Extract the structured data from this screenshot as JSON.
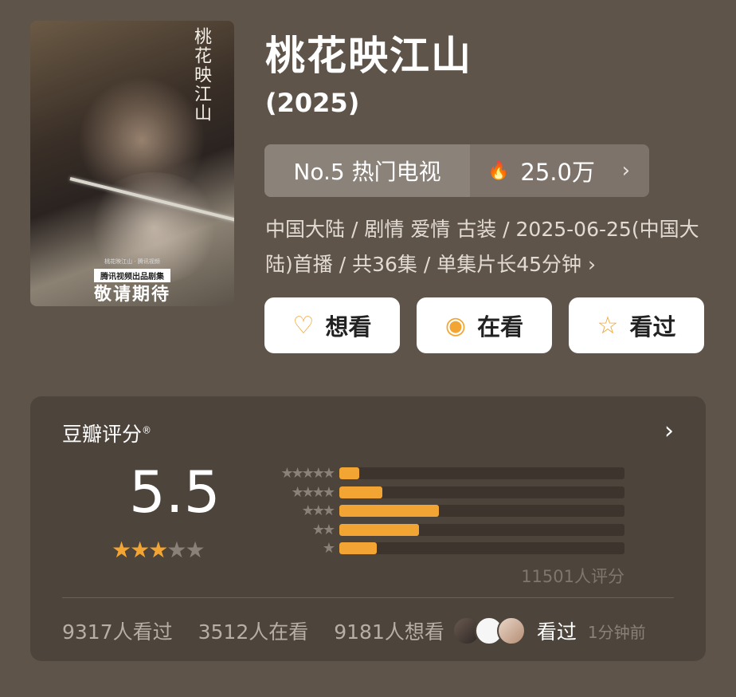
{
  "poster": {
    "calligraphy": "桃花映江山",
    "fineprint": "桃花映江山 · 腾讯视频",
    "presenter": "腾讯视频出品剧集",
    "coming_soon": "敬请期待"
  },
  "title": "桃花映江山",
  "year": "(2025)",
  "rank": {
    "label": "No.5 热门电视",
    "heat": "25.0万"
  },
  "meta": "中国大陆 / 剧情 爱情 古装 / 2025-06-25(中国大陆)首播 / 共36集 / 单集片长45分钟",
  "buttons": {
    "want": "想看",
    "watching": "在看",
    "watched": "看过"
  },
  "rating": {
    "title": "豆瓣评分",
    "title_mark": "®",
    "score": "5.5",
    "stars_filled": 3,
    "stars_total": 5,
    "distribution": [
      {
        "stars": 5,
        "fraction": 0.07
      },
      {
        "stars": 4,
        "fraction": 0.15
      },
      {
        "stars": 3,
        "fraction": 0.35
      },
      {
        "stars": 2,
        "fraction": 0.28
      },
      {
        "stars": 1,
        "fraction": 0.13
      }
    ],
    "count": "11501人评分"
  },
  "stats": {
    "watched": "9317人看过",
    "watching": "3512人在看",
    "want": "9181人想看",
    "recent_action": "看过",
    "recent_time": "1分钟前"
  },
  "colors": {
    "background": "#5f5449",
    "accent": "#f3a534"
  }
}
